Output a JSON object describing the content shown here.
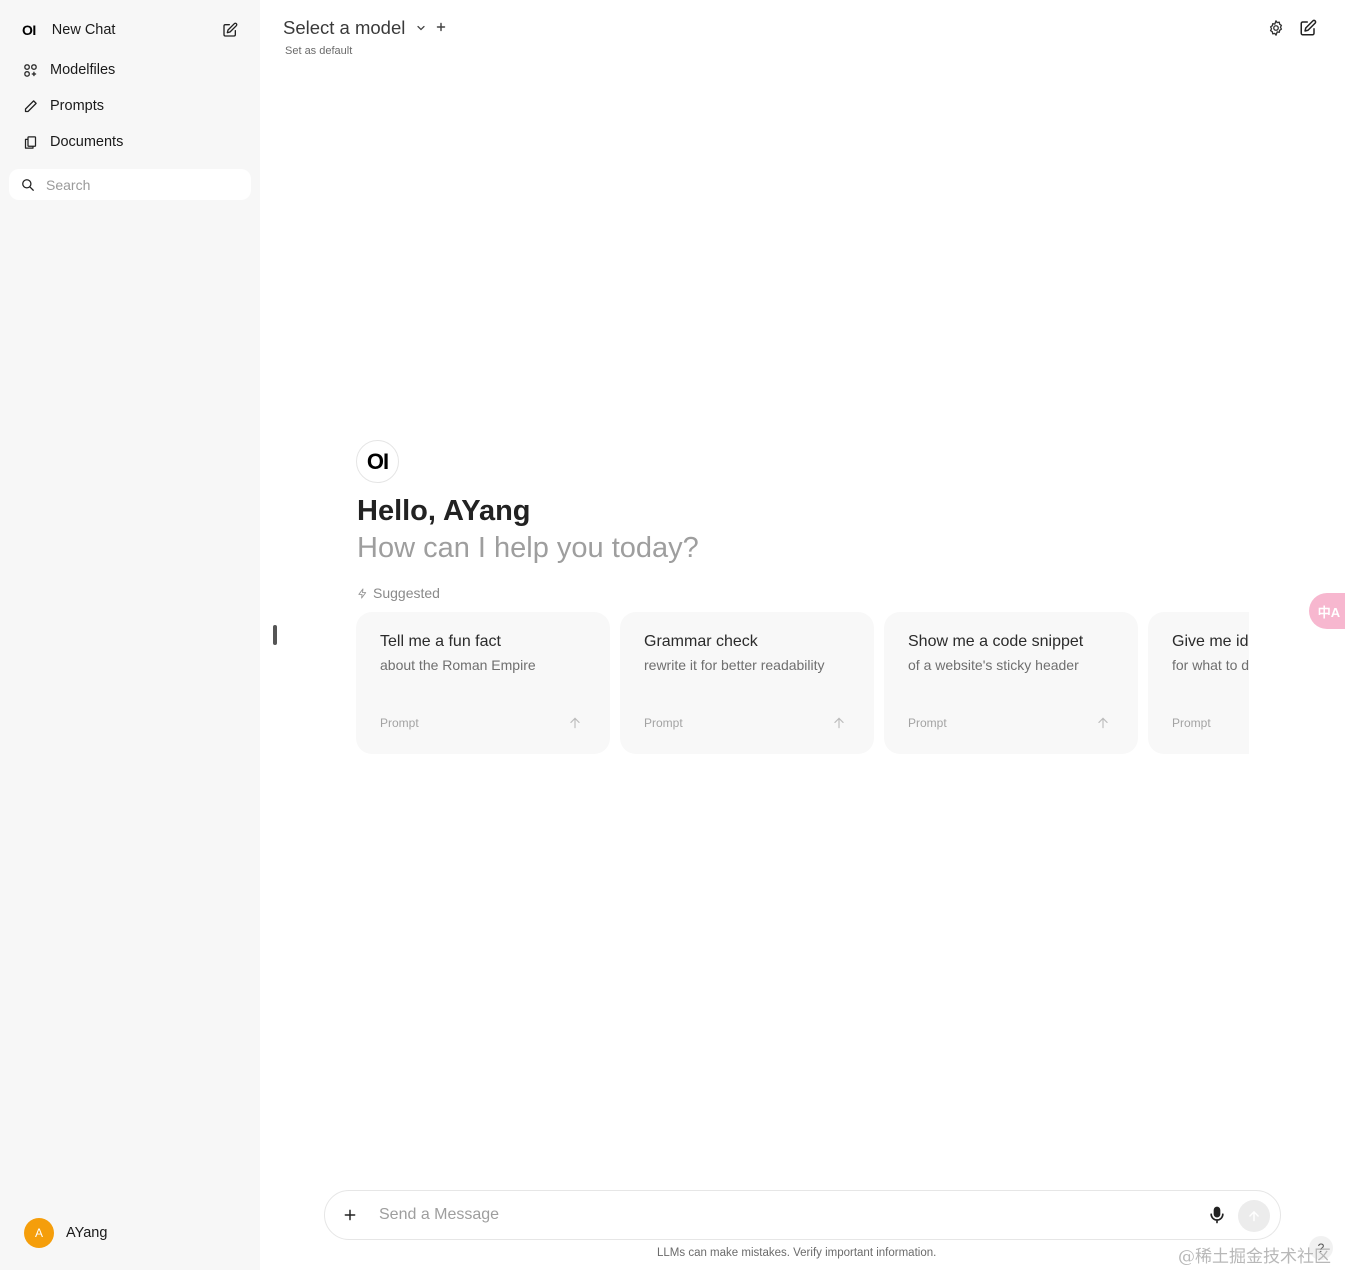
{
  "sidebar": {
    "logo_text": "OI",
    "new_chat": "New Chat",
    "items": [
      {
        "label": "Modelfiles",
        "icon": "modelfiles-icon"
      },
      {
        "label": "Prompts",
        "icon": "pencil-icon"
      },
      {
        "label": "Documents",
        "icon": "documents-icon"
      }
    ],
    "search_placeholder": "Search",
    "user": {
      "initial": "A",
      "name": "AYang",
      "avatar_color": "#f59e0b"
    }
  },
  "header": {
    "model_select": "Select a model",
    "set_default": "Set as default"
  },
  "hero": {
    "logo_text": "OI",
    "greeting": "Hello, AYang",
    "subtitle": "How can I help you today?",
    "suggested_label": "Suggested"
  },
  "suggestions": [
    {
      "title": "Tell me a fun fact",
      "subtitle": "about the Roman Empire",
      "tag": "Prompt"
    },
    {
      "title": "Grammar check",
      "subtitle": "rewrite it for better readability",
      "tag": "Prompt"
    },
    {
      "title": "Show me a code snippet",
      "subtitle": "of a website's sticky header",
      "tag": "Prompt"
    },
    {
      "title": "Give me ideas",
      "subtitle": "for what to do with my kids' art",
      "tag": "Prompt"
    }
  ],
  "composer": {
    "placeholder": "Send a Message",
    "disclaimer": "LLMs can make mistakes. Verify important information."
  },
  "help_label": "?",
  "translate_label": "中A",
  "watermark": "@稀土掘金技术社区",
  "colors": {
    "sidebar_bg": "#f7f7f7",
    "card_bg": "#f8f8f8",
    "avatar": "#f59e0b",
    "translate_btn": "#f7b7cf"
  }
}
